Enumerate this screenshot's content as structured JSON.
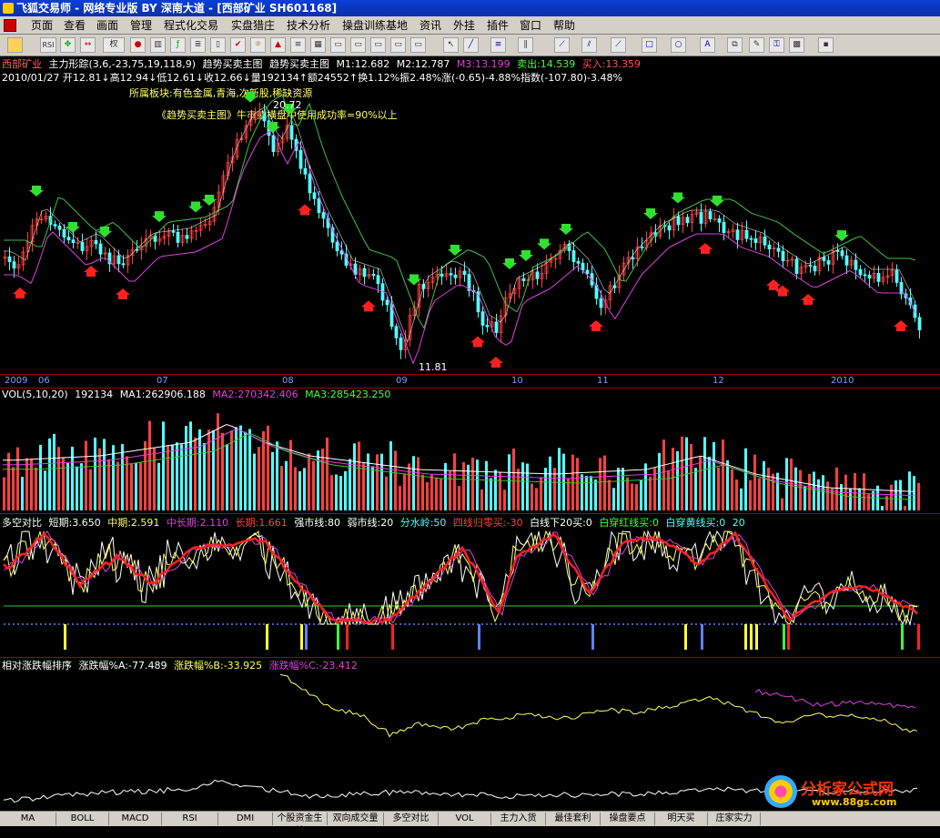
{
  "window": {
    "title": "飞狐交易师 - 网络专业版 BY 深南大道 - [西部矿业 SH601168]"
  },
  "menu": [
    "页面",
    "查看",
    "画面",
    "管理",
    "程式化交易",
    "实盘猎庄",
    "技术分析",
    "操盘训练基地",
    "资讯",
    "外挂",
    "插件",
    "窗口",
    "帮助"
  ],
  "toolbar": {
    "rsi_label": "RSI",
    "rights_label": "权"
  },
  "main_panel": {
    "stock_name": "西部矿业",
    "indicators": [
      "主力形踪(3,6,-23,75,19,118,9)",
      "趋势买卖主图",
      "趋势买卖主图"
    ],
    "m1": "M1:12.682",
    "m2": "M2:12.787",
    "m3": "M3:13.199",
    "sell": "卖出:14.539",
    "buy": "买入:13.359",
    "info_line": "2010/01/27  开12.81↓高12.94↓低12.61↓收12.66↓量192134↑额24552↑换1.12%振2.48%涨(-0.65)-4.88%指数(-107.80)-3.48%",
    "note1": "所属板块:有色金属,青海,次新股,稀缺资源",
    "note2": "《趋势买卖主图》牛市或横盘中使用成功率=90%以上",
    "high_label": "20.72",
    "low_label": "11.81"
  },
  "xaxis": [
    "2009",
    "06",
    "07",
    "08",
    "09",
    "10",
    "11",
    "12",
    "2010"
  ],
  "vol_panel": {
    "title": "VOL(5,10,20)",
    "vol": "192134",
    "ma1": "MA1:262906.188",
    "ma2": "MA2:270342.406",
    "ma3": "MA3:285423.250"
  },
  "dk_panel": {
    "title": "多空对比",
    "short": "短期:3.650",
    "mid": "中期:2.591",
    "midlong": "中长期:2.110",
    "long": "长期:1.661",
    "strong": "强市线:80",
    "weak": "弱市线:20",
    "watershed": "分水岭:50",
    "s1": "四线归零买:-30",
    "s2": "白线下20买:0",
    "s3": "白穿红线买:0",
    "s4": "白穿黄线买:0",
    "s4b": "20"
  },
  "rank_panel": {
    "title": "相对涨跌幅排序",
    "a": "涨跌幅%A:-77.489",
    "b": "涨跌幅%B:-33.925",
    "c": "涨跌幅%C:-23.412"
  },
  "tabs": [
    "MA",
    "BOLL",
    "MACD",
    "RSI",
    "DMI",
    "个股资金生效",
    "双向成交量",
    "多空对比",
    "VOL",
    "主力入货",
    "最佳套利",
    "操盘要点",
    "明天买",
    "庄家实力"
  ],
  "watermark": {
    "title": "分析家公式网",
    "url": "www.88gs.com"
  },
  "colors": {
    "up": "#ff4040",
    "down": "#54ffff",
    "ma_green": "#40c040",
    "ma_magenta": "#e040e0",
    "accent_yellow": "#ffff60"
  }
}
